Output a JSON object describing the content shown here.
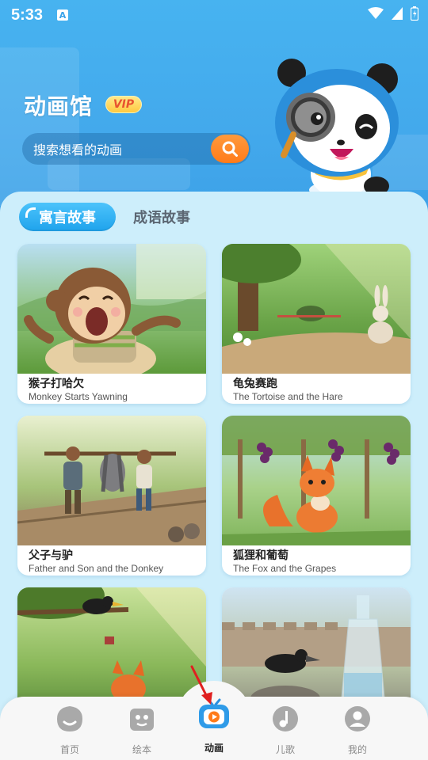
{
  "status_bar": {
    "time": "5:33",
    "badge": "A"
  },
  "header": {
    "title": "动画馆",
    "vip_badge": "VIP",
    "search_placeholder": "搜索想看的动画"
  },
  "tabs": [
    {
      "label": "寓言故事",
      "active": true
    },
    {
      "label": "成语故事",
      "active": false
    }
  ],
  "cards": [
    {
      "title_cn": "猴子打哈欠",
      "title_en": "Monkey Starts Yawning"
    },
    {
      "title_cn": "龟兔赛跑",
      "title_en": "The Tortoise and the Hare"
    },
    {
      "title_cn": "父子与驴",
      "title_en": "Father and Son and the Donkey"
    },
    {
      "title_cn": "狐狸和葡萄",
      "title_en": "The Fox and the Grapes"
    },
    {
      "title_cn": "",
      "title_en": ""
    },
    {
      "title_cn": "",
      "title_en": ""
    }
  ],
  "bottom_nav": [
    {
      "label": "首页",
      "icon": "home-icon",
      "active": false
    },
    {
      "label": "绘本",
      "icon": "picture-book-icon",
      "active": false
    },
    {
      "label": "动画",
      "icon": "tv-play-icon",
      "active": true
    },
    {
      "label": "儿歌",
      "icon": "music-note-icon",
      "active": false
    },
    {
      "label": "我的",
      "icon": "profile-icon",
      "active": false
    }
  ],
  "colors": {
    "header_blue": "#43a9ec",
    "accent_orange": "#ff7b1a",
    "tab_active": "#1fa3ec",
    "panel_bg": "#cdeefb"
  }
}
